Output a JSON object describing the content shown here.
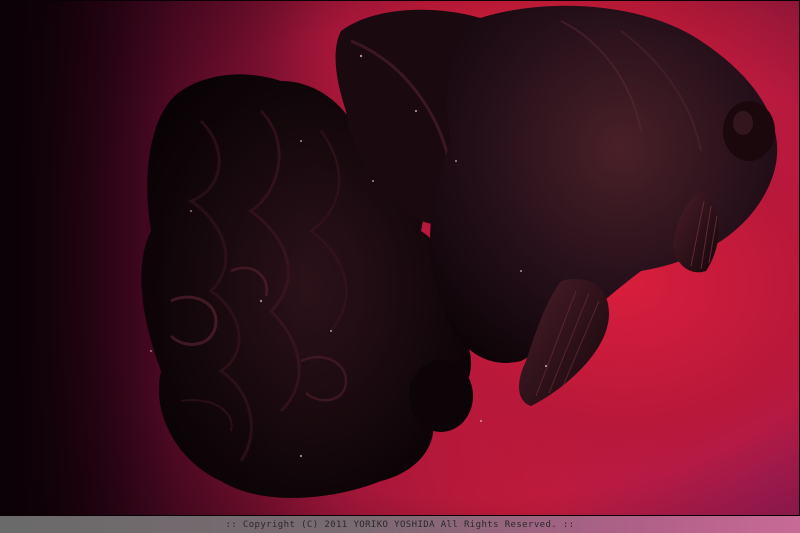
{
  "image": {
    "subject": "black-goldfish",
    "palette": {
      "background_primary": "#c81c3a",
      "background_dark": "#1a0410",
      "background_magenta": "#b41c48",
      "fish_body": "#1e0c12",
      "fish_highlight": "#5a2a36",
      "footer_bar": "#7a6a72"
    }
  },
  "footer": {
    "copyright_text": ":: Copyright (C) 2011 YORIKO YOSHIDA All Rights Reserved. ::"
  }
}
